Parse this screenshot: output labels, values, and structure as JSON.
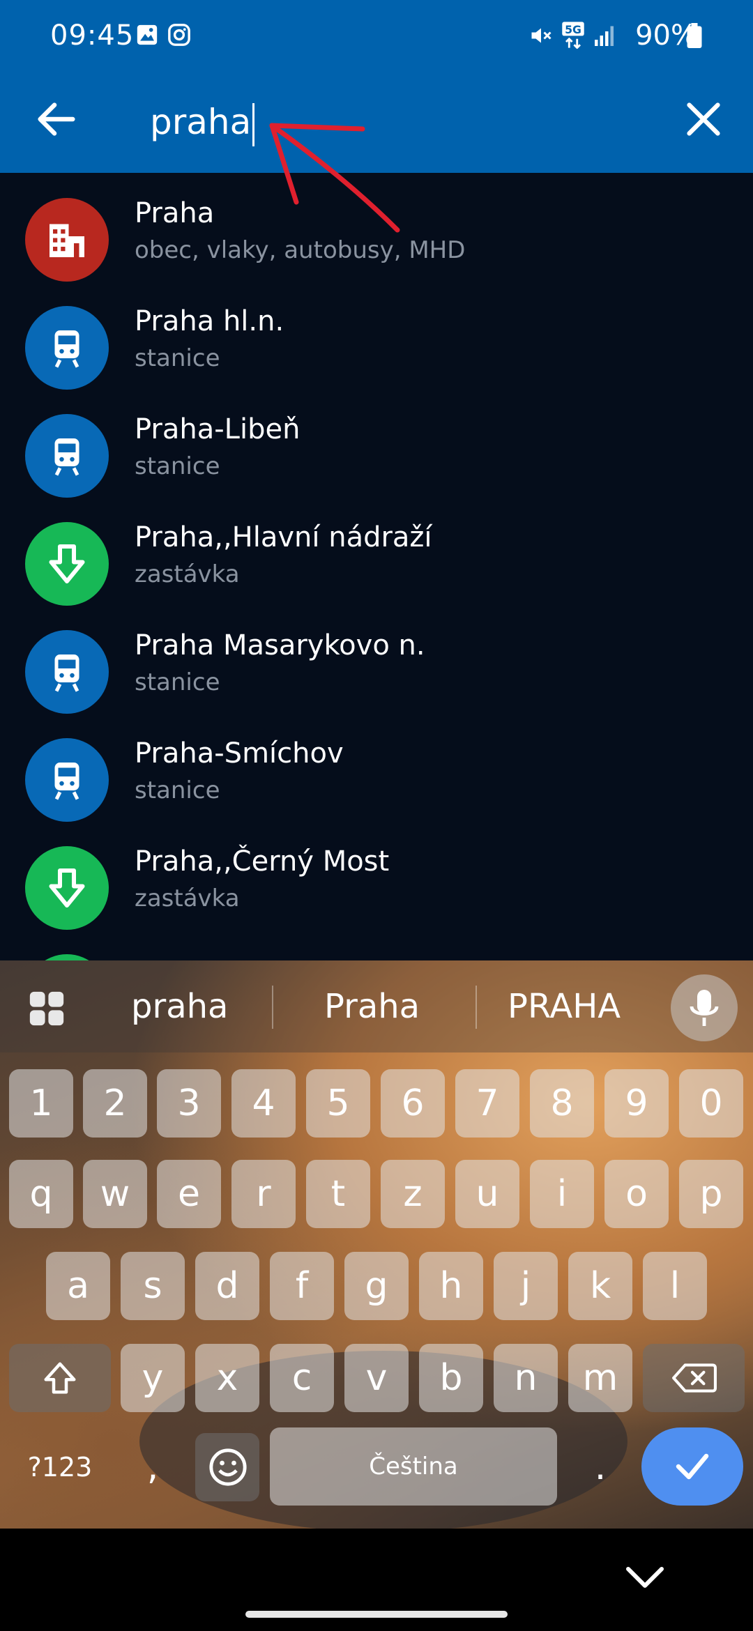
{
  "status_bar": {
    "time": "09:45",
    "battery": "90%",
    "icons": [
      "image-icon",
      "instagram-icon",
      "mute-icon",
      "5g-icon",
      "signal-icon",
      "battery-icon"
    ]
  },
  "search": {
    "query": "praha",
    "back_icon": "arrow-left-icon",
    "clear_icon": "close-icon"
  },
  "results": [
    {
      "title": "Praha",
      "subtitle": "obec, vlaky, autobusy, MHD",
      "type": "city",
      "color": "#b8281f",
      "icon": "city-icon"
    },
    {
      "title": "Praha hl.n.",
      "subtitle": "stanice",
      "type": "train-station",
      "color": "#0869b6",
      "icon": "train-icon"
    },
    {
      "title": "Praha-Libeň",
      "subtitle": "stanice",
      "type": "train-station",
      "color": "#0869b6",
      "icon": "train-icon"
    },
    {
      "title": "Praha,,Hlavní nádraží",
      "subtitle": "zastávka",
      "type": "stop",
      "color": "#17b856",
      "icon": "stop-icon"
    },
    {
      "title": "Praha Masarykovo n.",
      "subtitle": "stanice",
      "type": "train-station",
      "color": "#0869b6",
      "icon": "train-icon"
    },
    {
      "title": "Praha-Smíchov",
      "subtitle": "stanice",
      "type": "train-station",
      "color": "#0869b6",
      "icon": "train-icon"
    },
    {
      "title": "Praha,,Černý Most",
      "subtitle": "zastávka",
      "type": "stop",
      "color": "#17b856",
      "icon": "stop-icon"
    }
  ],
  "keyboard": {
    "suggestions": [
      "praha",
      "Praha",
      "PRAHA"
    ],
    "row_numbers": [
      "1",
      "2",
      "3",
      "4",
      "5",
      "6",
      "7",
      "8",
      "9",
      "0"
    ],
    "row_1": [
      "q",
      "w",
      "e",
      "r",
      "t",
      "z",
      "u",
      "i",
      "o",
      "p"
    ],
    "row_2": [
      "a",
      "s",
      "d",
      "f",
      "g",
      "h",
      "j",
      "k",
      "l"
    ],
    "row_3": [
      "y",
      "x",
      "c",
      "v",
      "b",
      "n",
      "m"
    ],
    "symbols_label": "?123",
    "comma": ",",
    "space_label": "Čeština",
    "period": "."
  }
}
